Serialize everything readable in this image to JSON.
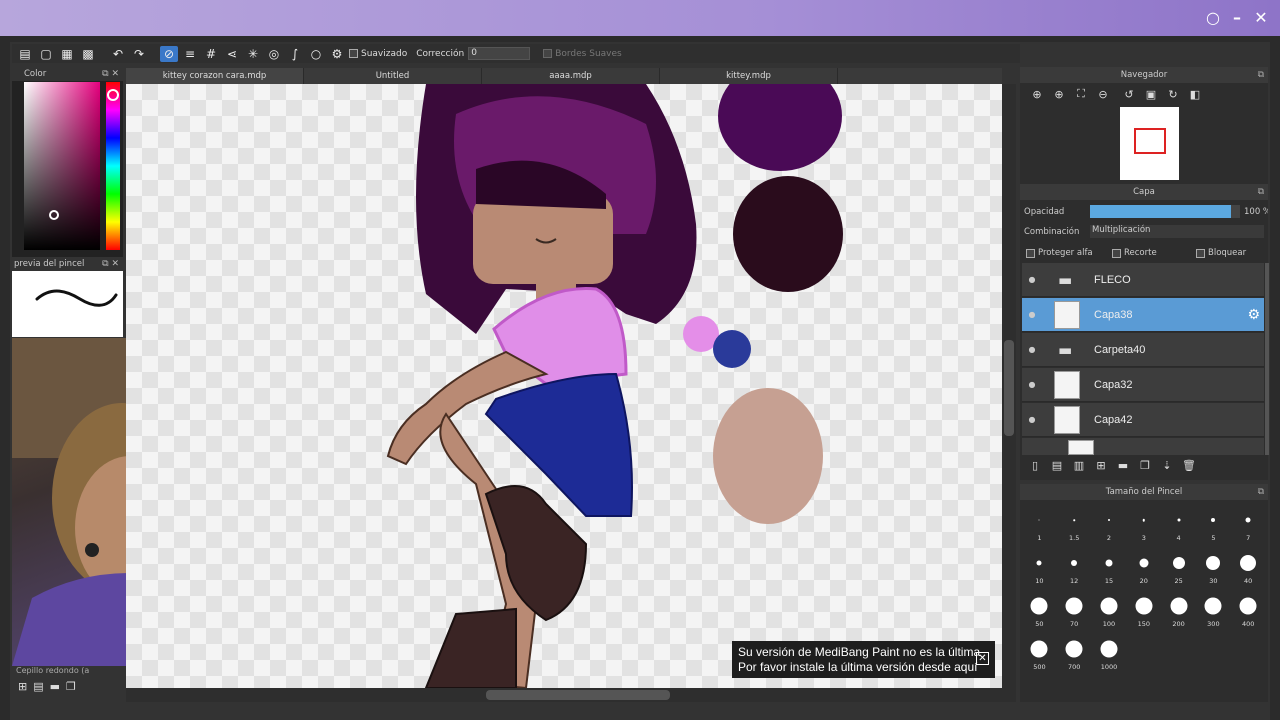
{
  "toolbar": {
    "suavizado_label": "Suavizado",
    "correccion_label": "Corrección",
    "correccion_value": "0",
    "bordes_label": "Bordes Suaves"
  },
  "left": {
    "color_title": "Color",
    "brush_preview_title": "previa del pincel",
    "brush_name": "Cepillo redondo (a"
  },
  "tabs": [
    "kittey corazon cara.mdp",
    "Untitled",
    "aaaa.mdp",
    "kittey.mdp"
  ],
  "navigator": {
    "title": "Navegador"
  },
  "layers": {
    "title": "Capa",
    "opacity_label": "Opacidad",
    "opacity_value": "100 %",
    "opacity_fraction": 0.94,
    "blend_label": "Combinación",
    "blend_value": "Multiplicación",
    "protect_alpha": "Proteger alfa",
    "clip": "Recorte",
    "lock": "Bloquear",
    "items": [
      {
        "name": "FLECO",
        "type": "folder",
        "selected": false
      },
      {
        "name": "Capa38",
        "type": "layer",
        "selected": true
      },
      {
        "name": "Carpeta40",
        "type": "folder",
        "selected": false
      },
      {
        "name": "Capa32",
        "type": "layer",
        "selected": false
      },
      {
        "name": "Capa42",
        "type": "layer",
        "selected": false
      }
    ]
  },
  "brush_size": {
    "title": "Tamaño del Pincel",
    "sizes": [
      "1",
      "1.5",
      "2",
      "3",
      "4",
      "5",
      "7",
      "10",
      "12",
      "15",
      "20",
      "25",
      "30",
      "40",
      "50",
      "70",
      "100",
      "150",
      "200",
      "300",
      "400",
      "500",
      "700",
      "1000"
    ]
  },
  "notice": {
    "line1": "Su versión de MediBang Paint no es la última",
    "line2": "Por favor instale la última versión desde aquí"
  },
  "colors": {
    "accent": "#5a9bd5",
    "titlebar": "#a58fd6",
    "current_color": "#e6007e"
  }
}
